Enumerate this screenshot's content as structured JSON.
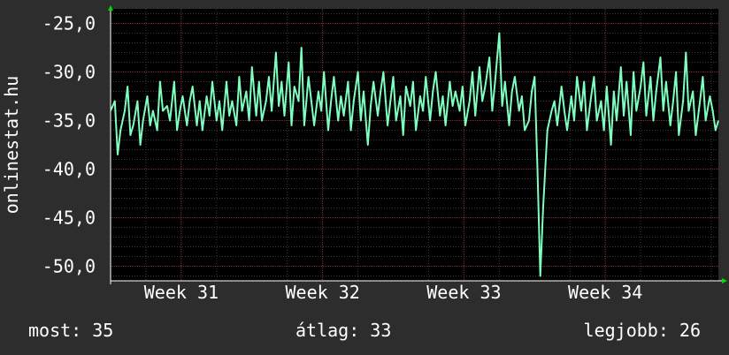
{
  "chart_data": {
    "type": "line",
    "ylabel": "onlinestat.hu",
    "ylim": [
      -51.5,
      -23.5
    ],
    "xlim": [
      0,
      4.3
    ],
    "grid": true,
    "y_ticks": [
      -25.0,
      -30.0,
      -35.0,
      -40.0,
      -45.0,
      -50.0
    ],
    "y_tick_labels": [
      "-25,0",
      "-30,0",
      "-35,0",
      "-40,0",
      "-45,0",
      "-50,0"
    ],
    "x_ticks": [
      0.5,
      1.5,
      2.5,
      3.5
    ],
    "x_tick_labels": [
      "Week 31",
      "Week 32",
      "Week 33",
      "Week 34"
    ],
    "series": [
      {
        "color": "#7fffbf",
        "points": [
          [
            0.0,
            -34.0
          ],
          [
            0.03,
            -33.0
          ],
          [
            0.05,
            -38.5
          ],
          [
            0.07,
            -36.0
          ],
          [
            0.1,
            -34.0
          ],
          [
            0.12,
            -31.5
          ],
          [
            0.14,
            -36.5
          ],
          [
            0.16,
            -35.5
          ],
          [
            0.19,
            -33.0
          ],
          [
            0.21,
            -37.5
          ],
          [
            0.23,
            -35.0
          ],
          [
            0.26,
            -32.5
          ],
          [
            0.28,
            -35.5
          ],
          [
            0.3,
            -34.0
          ],
          [
            0.33,
            -36.0
          ],
          [
            0.35,
            -31.0
          ],
          [
            0.37,
            -34.0
          ],
          [
            0.4,
            -33.5
          ],
          [
            0.42,
            -35.0
          ],
          [
            0.45,
            -31.0
          ],
          [
            0.47,
            -36.0
          ],
          [
            0.49,
            -34.0
          ],
          [
            0.51,
            -32.5
          ],
          [
            0.54,
            -35.5
          ],
          [
            0.56,
            -33.0
          ],
          [
            0.58,
            -31.5
          ],
          [
            0.61,
            -35.5
          ],
          [
            0.63,
            -33.0
          ],
          [
            0.65,
            -36.0
          ],
          [
            0.68,
            -32.5
          ],
          [
            0.7,
            -34.5
          ],
          [
            0.72,
            -31.0
          ],
          [
            0.75,
            -35.0
          ],
          [
            0.77,
            -33.0
          ],
          [
            0.79,
            -36.0
          ],
          [
            0.82,
            -31.0
          ],
          [
            0.84,
            -34.5
          ],
          [
            0.86,
            -33.0
          ],
          [
            0.89,
            -35.5
          ],
          [
            0.91,
            -30.5
          ],
          [
            0.93,
            -34.0
          ],
          [
            0.96,
            -32.0
          ],
          [
            0.98,
            -35.0
          ],
          [
            1.0,
            -29.5
          ],
          [
            1.03,
            -34.5
          ],
          [
            1.05,
            -31.0
          ],
          [
            1.07,
            -35.0
          ],
          [
            1.1,
            -33.0
          ],
          [
            1.12,
            -30.5
          ],
          [
            1.14,
            -34.0
          ],
          [
            1.17,
            -28.0
          ],
          [
            1.19,
            -33.5
          ],
          [
            1.21,
            -31.0
          ],
          [
            1.23,
            -34.5
          ],
          [
            1.26,
            -29.0
          ],
          [
            1.28,
            -35.5
          ],
          [
            1.3,
            -31.5
          ],
          [
            1.33,
            -33.0
          ],
          [
            1.35,
            -27.5
          ],
          [
            1.37,
            -35.5
          ],
          [
            1.4,
            -30.5
          ],
          [
            1.42,
            -33.0
          ],
          [
            1.44,
            -35.5
          ],
          [
            1.47,
            -32.0
          ],
          [
            1.49,
            -34.0
          ],
          [
            1.51,
            -30.0
          ],
          [
            1.54,
            -36.0
          ],
          [
            1.56,
            -33.0
          ],
          [
            1.58,
            -30.5
          ],
          [
            1.61,
            -35.0
          ],
          [
            1.63,
            -32.5
          ],
          [
            1.65,
            -34.5
          ],
          [
            1.68,
            -31.0
          ],
          [
            1.7,
            -36.0
          ],
          [
            1.72,
            -33.0
          ],
          [
            1.75,
            -30.0
          ],
          [
            1.77,
            -35.0
          ],
          [
            1.79,
            -32.0
          ],
          [
            1.82,
            -37.5
          ],
          [
            1.84,
            -33.5
          ],
          [
            1.86,
            -31.0
          ],
          [
            1.89,
            -34.5
          ],
          [
            1.91,
            -32.0
          ],
          [
            1.93,
            -30.0
          ],
          [
            1.96,
            -35.5
          ],
          [
            1.98,
            -33.0
          ],
          [
            2.0,
            -30.5
          ],
          [
            2.02,
            -35.0
          ],
          [
            2.05,
            -32.5
          ],
          [
            2.07,
            -36.5
          ],
          [
            2.09,
            -31.5
          ],
          [
            2.12,
            -33.5
          ],
          [
            2.14,
            -31.0
          ],
          [
            2.16,
            -36.0
          ],
          [
            2.19,
            -32.5
          ],
          [
            2.21,
            -34.0
          ],
          [
            2.23,
            -30.5
          ],
          [
            2.26,
            -35.0
          ],
          [
            2.28,
            -32.0
          ],
          [
            2.3,
            -30.0
          ],
          [
            2.33,
            -34.5
          ],
          [
            2.35,
            -32.5
          ],
          [
            2.37,
            -35.5
          ],
          [
            2.4,
            -31.0
          ],
          [
            2.42,
            -33.5
          ],
          [
            2.44,
            -32.0
          ],
          [
            2.47,
            -34.0
          ],
          [
            2.49,
            -31.5
          ],
          [
            2.51,
            -35.5
          ],
          [
            2.54,
            -33.0
          ],
          [
            2.56,
            -30.0
          ],
          [
            2.58,
            -34.5
          ],
          [
            2.61,
            -29.5
          ],
          [
            2.63,
            -33.0
          ],
          [
            2.65,
            -31.5
          ],
          [
            2.68,
            -28.5
          ],
          [
            2.7,
            -34.0
          ],
          [
            2.72,
            -31.0
          ],
          [
            2.75,
            -26.0
          ],
          [
            2.77,
            -33.5
          ],
          [
            2.79,
            -31.0
          ],
          [
            2.82,
            -35.5
          ],
          [
            2.84,
            -32.0
          ],
          [
            2.86,
            -30.5
          ],
          [
            2.89,
            -34.0
          ],
          [
            2.91,
            -32.5
          ],
          [
            2.93,
            -36.0
          ],
          [
            2.96,
            -35.0
          ],
          [
            2.98,
            -32.0
          ],
          [
            3.0,
            -30.5
          ],
          [
            3.02,
            -40.0
          ],
          [
            3.04,
            -51.0
          ],
          [
            3.06,
            -44.0
          ],
          [
            3.09,
            -36.0
          ],
          [
            3.12,
            -34.0
          ],
          [
            3.14,
            -33.0
          ],
          [
            3.16,
            -35.5
          ],
          [
            3.19,
            -31.5
          ],
          [
            3.21,
            -34.0
          ],
          [
            3.23,
            -36.0
          ],
          [
            3.26,
            -32.5
          ],
          [
            3.28,
            -35.0
          ],
          [
            3.3,
            -30.5
          ],
          [
            3.33,
            -34.0
          ],
          [
            3.35,
            -31.0
          ],
          [
            3.37,
            -36.0
          ],
          [
            3.4,
            -32.5
          ],
          [
            3.42,
            -30.5
          ],
          [
            3.44,
            -35.0
          ],
          [
            3.47,
            -33.0
          ],
          [
            3.49,
            -36.0
          ],
          [
            3.51,
            -31.5
          ],
          [
            3.54,
            -37.5
          ],
          [
            3.56,
            -32.0
          ],
          [
            3.58,
            -35.0
          ],
          [
            3.61,
            -29.5
          ],
          [
            3.63,
            -34.5
          ],
          [
            3.65,
            -31.0
          ],
          [
            3.68,
            -36.5
          ],
          [
            3.7,
            -30.0
          ],
          [
            3.72,
            -34.0
          ],
          [
            3.75,
            -31.5
          ],
          [
            3.77,
            -29.0
          ],
          [
            3.79,
            -34.5
          ],
          [
            3.82,
            -30.5
          ],
          [
            3.84,
            -35.0
          ],
          [
            3.86,
            -32.0
          ],
          [
            3.89,
            -28.5
          ],
          [
            3.91,
            -34.0
          ],
          [
            3.93,
            -31.0
          ],
          [
            3.96,
            -35.5
          ],
          [
            3.98,
            -33.0
          ],
          [
            4.0,
            -30.0
          ],
          [
            4.02,
            -36.5
          ],
          [
            4.05,
            -33.0
          ],
          [
            4.07,
            -28.0
          ],
          [
            4.09,
            -34.0
          ],
          [
            4.12,
            -32.0
          ],
          [
            4.14,
            -36.5
          ],
          [
            4.17,
            -33.0
          ],
          [
            4.19,
            -30.5
          ],
          [
            4.21,
            -35.0
          ],
          [
            4.24,
            -32.5
          ],
          [
            4.26,
            -34.0
          ],
          [
            4.28,
            -36.0
          ],
          [
            4.3,
            -35.0
          ]
        ]
      }
    ]
  },
  "legend": {
    "now": "most: 35",
    "average": "átlag: 33",
    "best": "legjobb: 26"
  },
  "colors": {
    "background": "#2d2d2d",
    "plot_background": "#000000",
    "grid_major": "#8a2a2a",
    "grid_minor": "#3a3a3a",
    "line": "#7fffbf",
    "axis_arrow": "#00dd00",
    "text": "#ffffff"
  }
}
